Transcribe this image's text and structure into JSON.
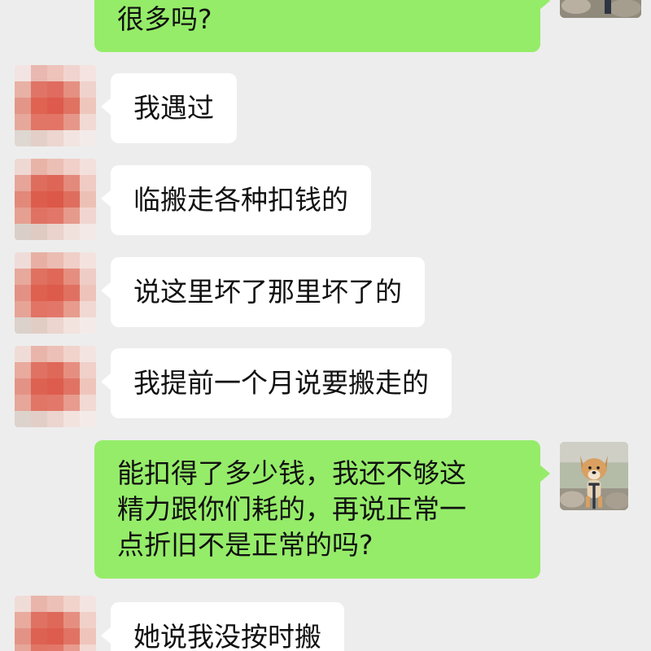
{
  "conversation": {
    "messages": [
      {
        "sender": "self",
        "lines": [
          "很多吗?"
        ]
      },
      {
        "sender": "other",
        "lines": [
          "我遇过"
        ]
      },
      {
        "sender": "other",
        "lines": [
          "临搬走各种扣钱的"
        ]
      },
      {
        "sender": "other",
        "lines": [
          "说这里坏了那里坏了的"
        ]
      },
      {
        "sender": "other",
        "lines": [
          "我提前一个月说要搬走的"
        ]
      },
      {
        "sender": "self",
        "lines": [
          "能扣得了多少钱，我还不够这",
          "精力跟你们耗的，再说正常一",
          "点折旧不是正常的吗?"
        ]
      },
      {
        "sender": "other",
        "lines": [
          "她说我没按时搬"
        ]
      }
    ]
  },
  "colors": {
    "background": "#ededed",
    "self_bubble": "#95ec69",
    "other_bubble": "#ffffff",
    "text": "#111111"
  },
  "icons": {
    "other_avatar": "pixelated-avatar",
    "self_avatar": "dog-photo-avatar"
  }
}
